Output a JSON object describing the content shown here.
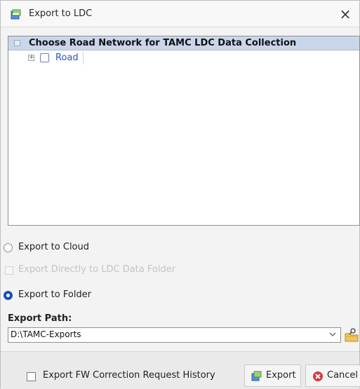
{
  "window": {
    "title": "Export to LDC",
    "close_glyph": "×",
    "app_icon": "export-ldc-icon"
  },
  "tree": {
    "header": "Choose Road Network for TAMC LDC Data Collection",
    "items": [
      {
        "label": "Road",
        "expander": "+",
        "checked": false
      }
    ]
  },
  "options": {
    "cloud_label": "Export to Cloud",
    "direct_label": "Export Directly to LDC Data Folder",
    "folder_label": "Export to Folder",
    "selected": "folder"
  },
  "export_path": {
    "label": "Export Path:",
    "value": "D:\\TAMC-Exports"
  },
  "footer": {
    "history_label": "Export FW Correction Request History",
    "export_label": "Export",
    "cancel_label": "Cancel"
  },
  "colors": {
    "accent": "#1c4fb5",
    "header_bg": "#cad6ea",
    "cancel_red": "#d33a3a"
  }
}
